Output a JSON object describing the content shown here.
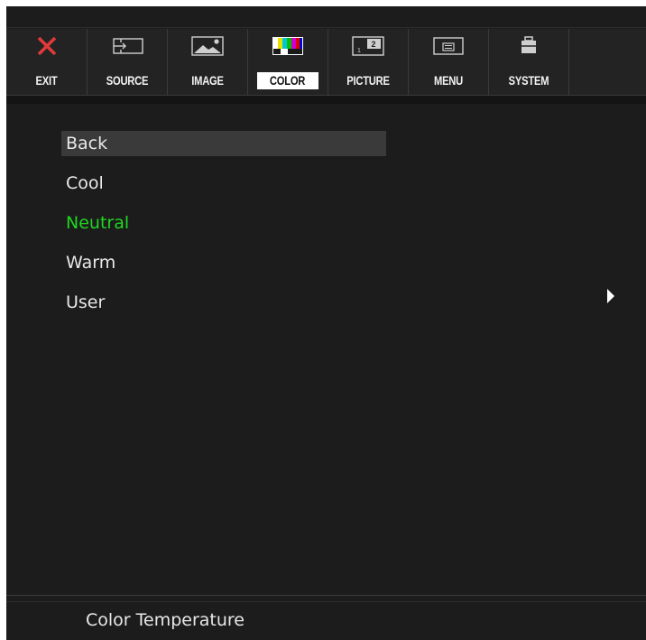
{
  "toolbar": {
    "tabs": [
      {
        "label": "EXIT",
        "icon": "close-icon"
      },
      {
        "label": "SOURCE",
        "icon": "input-icon"
      },
      {
        "label": "IMAGE",
        "icon": "image-icon"
      },
      {
        "label": "COLOR",
        "icon": "color-bars-icon",
        "active": true
      },
      {
        "label": "PICTURE",
        "icon": "picture-in-picture-icon"
      },
      {
        "label": "MENU",
        "icon": "menu-icon"
      },
      {
        "label": "SYSTEM",
        "icon": "toolbox-icon"
      }
    ]
  },
  "menu": {
    "items": [
      {
        "label": "Back",
        "selected": true
      },
      {
        "label": "Cool"
      },
      {
        "label": "Neutral",
        "current": true
      },
      {
        "label": "Warm"
      },
      {
        "label": "User",
        "has_submenu": true
      }
    ]
  },
  "status": {
    "text": "Color Temperature"
  },
  "colors": {
    "accent_current": "#1fd81f",
    "exit_icon": "#e03a3a",
    "background": "#1c1c1c",
    "highlight": "#3a3a3a"
  }
}
